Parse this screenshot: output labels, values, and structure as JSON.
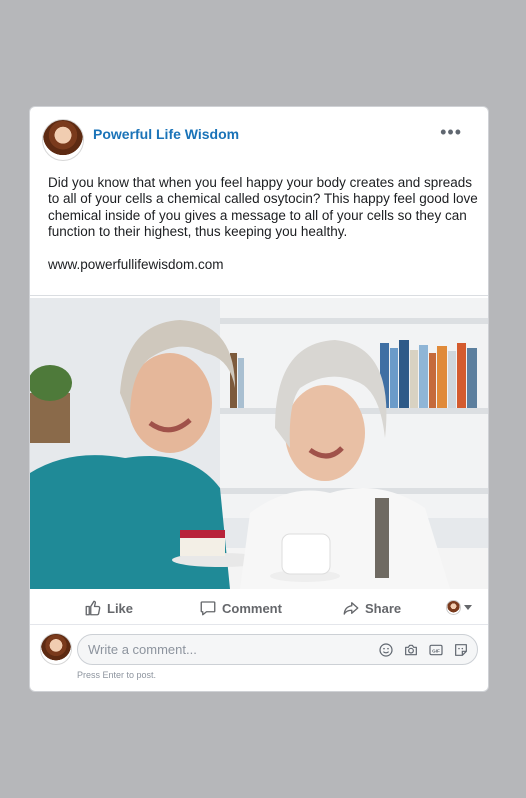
{
  "post": {
    "page_name": "Powerful Life Wisdom",
    "more_icon": "more-horizontal-icon",
    "text": "Did you know that when you feel happy your body creates and spreads to all of your cells a chemical called osytocin? This happy feel good love chemical inside of you gives a message to all of your cells so they can function to their highest, thus keeping you healthy.",
    "link": "www.powerfullifewisdom.com",
    "photo_icon": "photo-two-women-laughing-with-cake-and-tea"
  },
  "actions": {
    "like_label": "Like",
    "comment_label": "Comment",
    "share_label": "Share"
  },
  "composer": {
    "placeholder": "Write a comment...",
    "hint": "Press Enter to post.",
    "icons": [
      "emoji-icon",
      "camera-icon",
      "gif-icon",
      "sticker-icon"
    ]
  },
  "colors": {
    "background": "#b6b7ba",
    "page_name": "#1a73b8",
    "action_text": "#65676b"
  }
}
